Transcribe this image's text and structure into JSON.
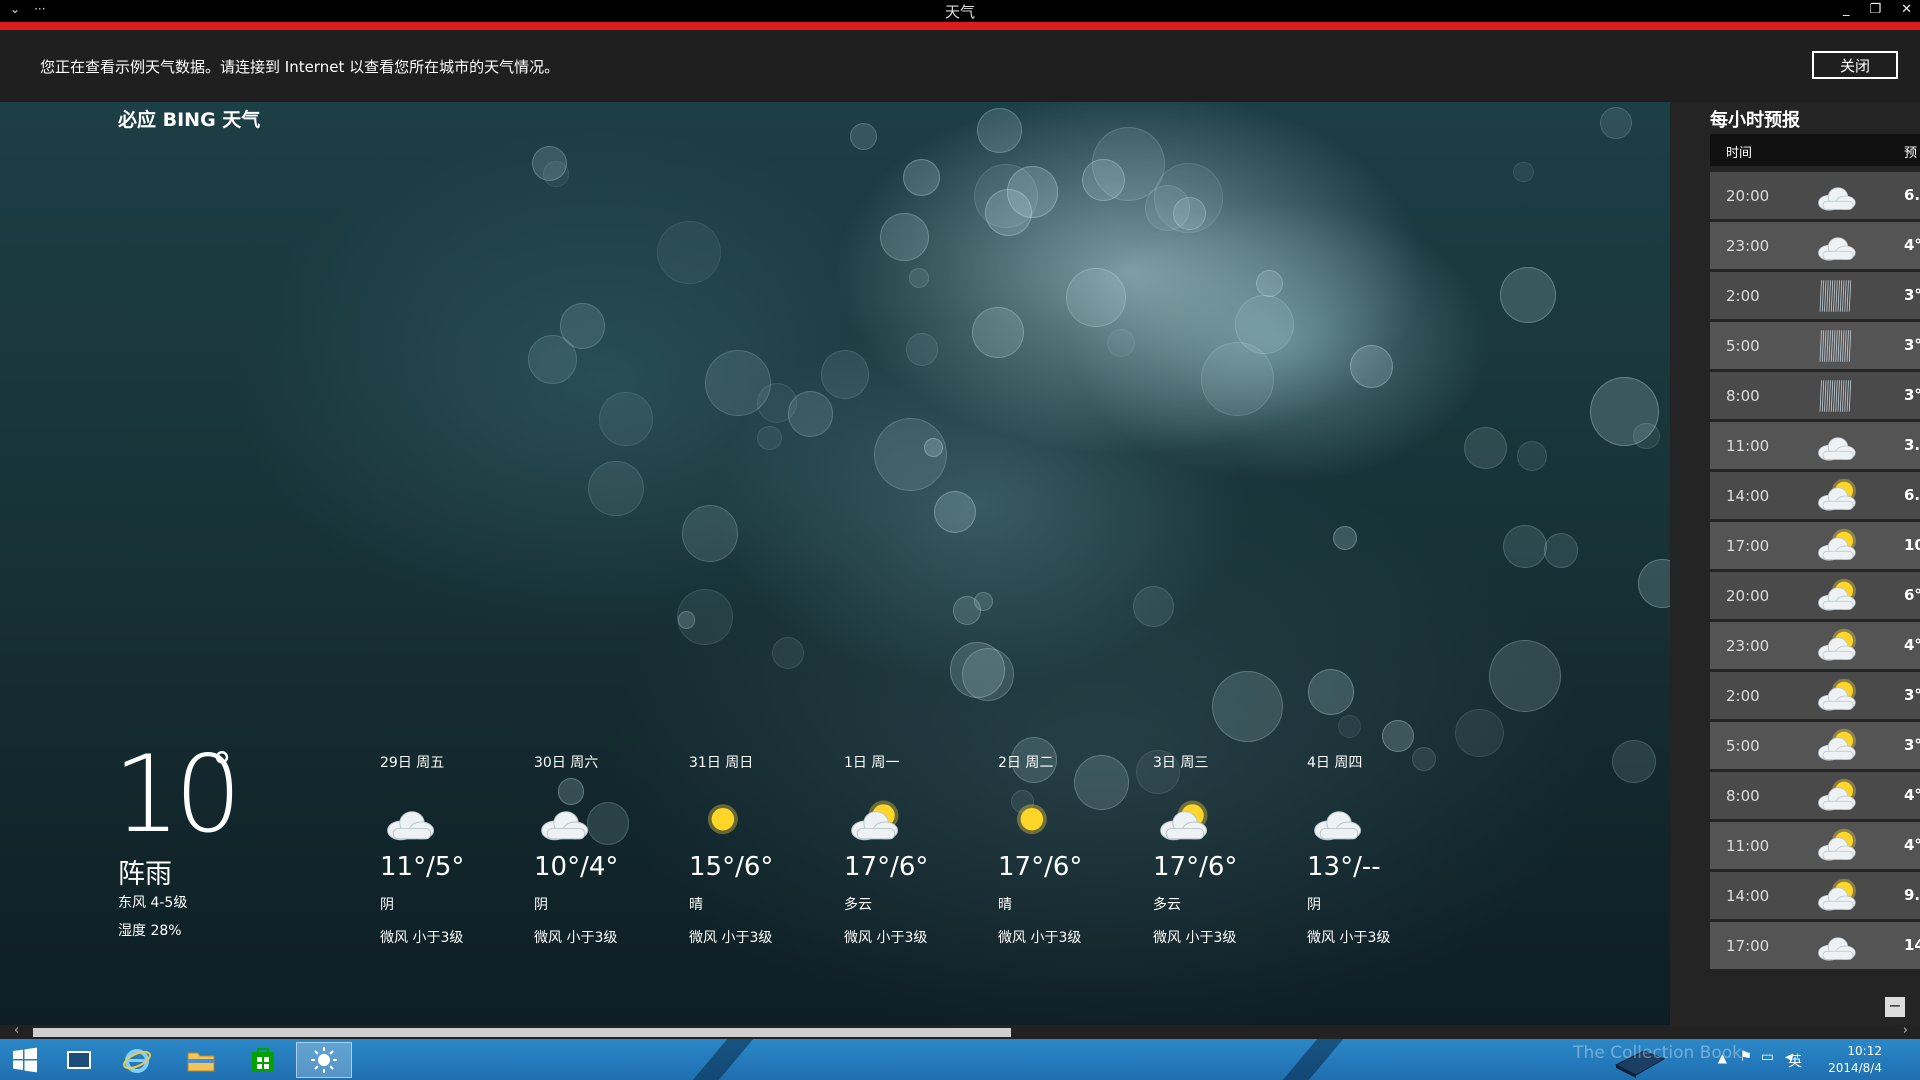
{
  "window": {
    "title": "天气",
    "menu_icon": "chevron-down-icon",
    "more_label": "···",
    "min_label": "_",
    "restore_label": "❐",
    "close_label": "✕"
  },
  "notice": {
    "text": "您正在查看示例天气数据。请连接到 Internet 以查看您所在城市的天气情况。",
    "close_label": "关闭"
  },
  "brand": "必应 BING 天气",
  "current": {
    "temp": "10",
    "degree": "°",
    "condition": "阵雨",
    "wind": "东风 4-5级",
    "humidity": "湿度 28%"
  },
  "forecast": [
    {
      "date": "29日 周五",
      "icon": "cloudy",
      "temp": "11°/5°",
      "cond": "阴",
      "wind": "微风 小于3级"
    },
    {
      "date": "30日 周六",
      "icon": "cloudy",
      "temp": "10°/4°",
      "cond": "阴",
      "wind": "微风 小于3级"
    },
    {
      "date": "31日 周日",
      "icon": "sunny",
      "temp": "15°/6°",
      "cond": "晴",
      "wind": "微风 小于3级"
    },
    {
      "date": "1日 周一",
      "icon": "partly-cloudy",
      "temp": "17°/6°",
      "cond": "多云",
      "wind": "微风 小于3级"
    },
    {
      "date": "2日 周二",
      "icon": "sunny",
      "temp": "17°/6°",
      "cond": "晴",
      "wind": "微风 小于3级"
    },
    {
      "date": "3日 周三",
      "icon": "partly-cloudy",
      "temp": "17°/6°",
      "cond": "多云",
      "wind": "微风 小于3级"
    },
    {
      "date": "4日 周四",
      "icon": "cloudy",
      "temp": "13°/--",
      "cond": "阴",
      "wind": "微风 小于3级"
    }
  ],
  "hourly": {
    "title": "每小时预报",
    "col_time": "时间",
    "col_forecast": "预",
    "rows": [
      {
        "time": "20:00",
        "icon": "cloudy",
        "temp": "6."
      },
      {
        "time": "23:00",
        "icon": "cloudy",
        "temp": "4°"
      },
      {
        "time": "2:00",
        "icon": "rain",
        "temp": "3°"
      },
      {
        "time": "5:00",
        "icon": "rain",
        "temp": "3°"
      },
      {
        "time": "8:00",
        "icon": "rain",
        "temp": "3°"
      },
      {
        "time": "11:00",
        "icon": "cloudy",
        "temp": "3."
      },
      {
        "time": "14:00",
        "icon": "partly-cloudy",
        "temp": "6."
      },
      {
        "time": "17:00",
        "icon": "partly-cloudy",
        "temp": "10"
      },
      {
        "time": "20:00",
        "icon": "partly-cloudy",
        "temp": "6°"
      },
      {
        "time": "23:00",
        "icon": "partly-cloudy",
        "temp": "4°"
      },
      {
        "time": "2:00",
        "icon": "partly-cloudy",
        "temp": "3°"
      },
      {
        "time": "5:00",
        "icon": "partly-cloudy",
        "temp": "3°"
      },
      {
        "time": "8:00",
        "icon": "partly-cloudy",
        "temp": "4°"
      },
      {
        "time": "11:00",
        "icon": "partly-cloudy",
        "temp": "4°"
      },
      {
        "time": "14:00",
        "icon": "partly-cloudy",
        "temp": "9."
      },
      {
        "time": "17:00",
        "icon": "cloudy",
        "temp": "14"
      }
    ]
  },
  "zoom_button": "−",
  "taskbar": {
    "apps": [
      "start-icon",
      "desktop-icon",
      "internet-explorer-icon",
      "file-explorer-icon",
      "store-icon",
      "weather-icon"
    ],
    "ime": "英",
    "time": "10:12",
    "date": "2014/8/4",
    "watermark": "The Collection Book"
  },
  "colors": {
    "accent": "#e01d1d",
    "taskbar": "#2b88c8",
    "panel": "#242424"
  }
}
